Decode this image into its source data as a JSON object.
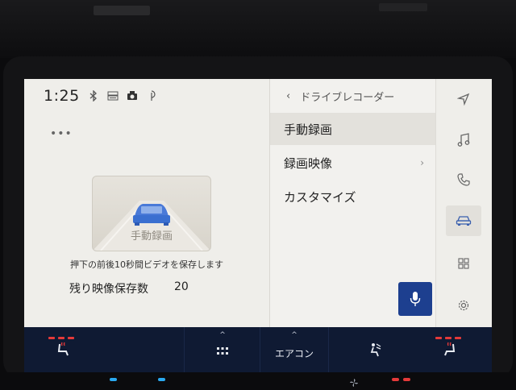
{
  "status": {
    "time": "1:25",
    "icons": [
      "bluetooth-icon",
      "etc-icon",
      "dashcam-icon",
      "wireless-charge-icon"
    ]
  },
  "left": {
    "more_glyph": "•••",
    "record_button_label": "手動録画",
    "hint": "押下の前後10秒間ビデオを保存します",
    "remaining_label": "残り映像保存数",
    "remaining_value": "20"
  },
  "menu": {
    "back_glyph": "‹",
    "title": "ドライブレコーダー",
    "items": [
      {
        "label": "手動録画",
        "selected": true
      },
      {
        "label": "録画映像",
        "chevron": "›"
      },
      {
        "label": "カスタマイズ"
      }
    ]
  },
  "rail": {
    "items": [
      "navigation-icon",
      "music-icon",
      "phone-icon",
      "car-icon",
      "apps-icon",
      "settings-icon"
    ],
    "active": "car-icon"
  },
  "bottom": {
    "caret": "^",
    "climate_label": "エアコン"
  },
  "colors": {
    "accent_blue": "#1d3f8f",
    "car_blue": "#3a6fd0",
    "bottom_bar": "#0f1a33",
    "heat_red": "#e53a3a"
  }
}
